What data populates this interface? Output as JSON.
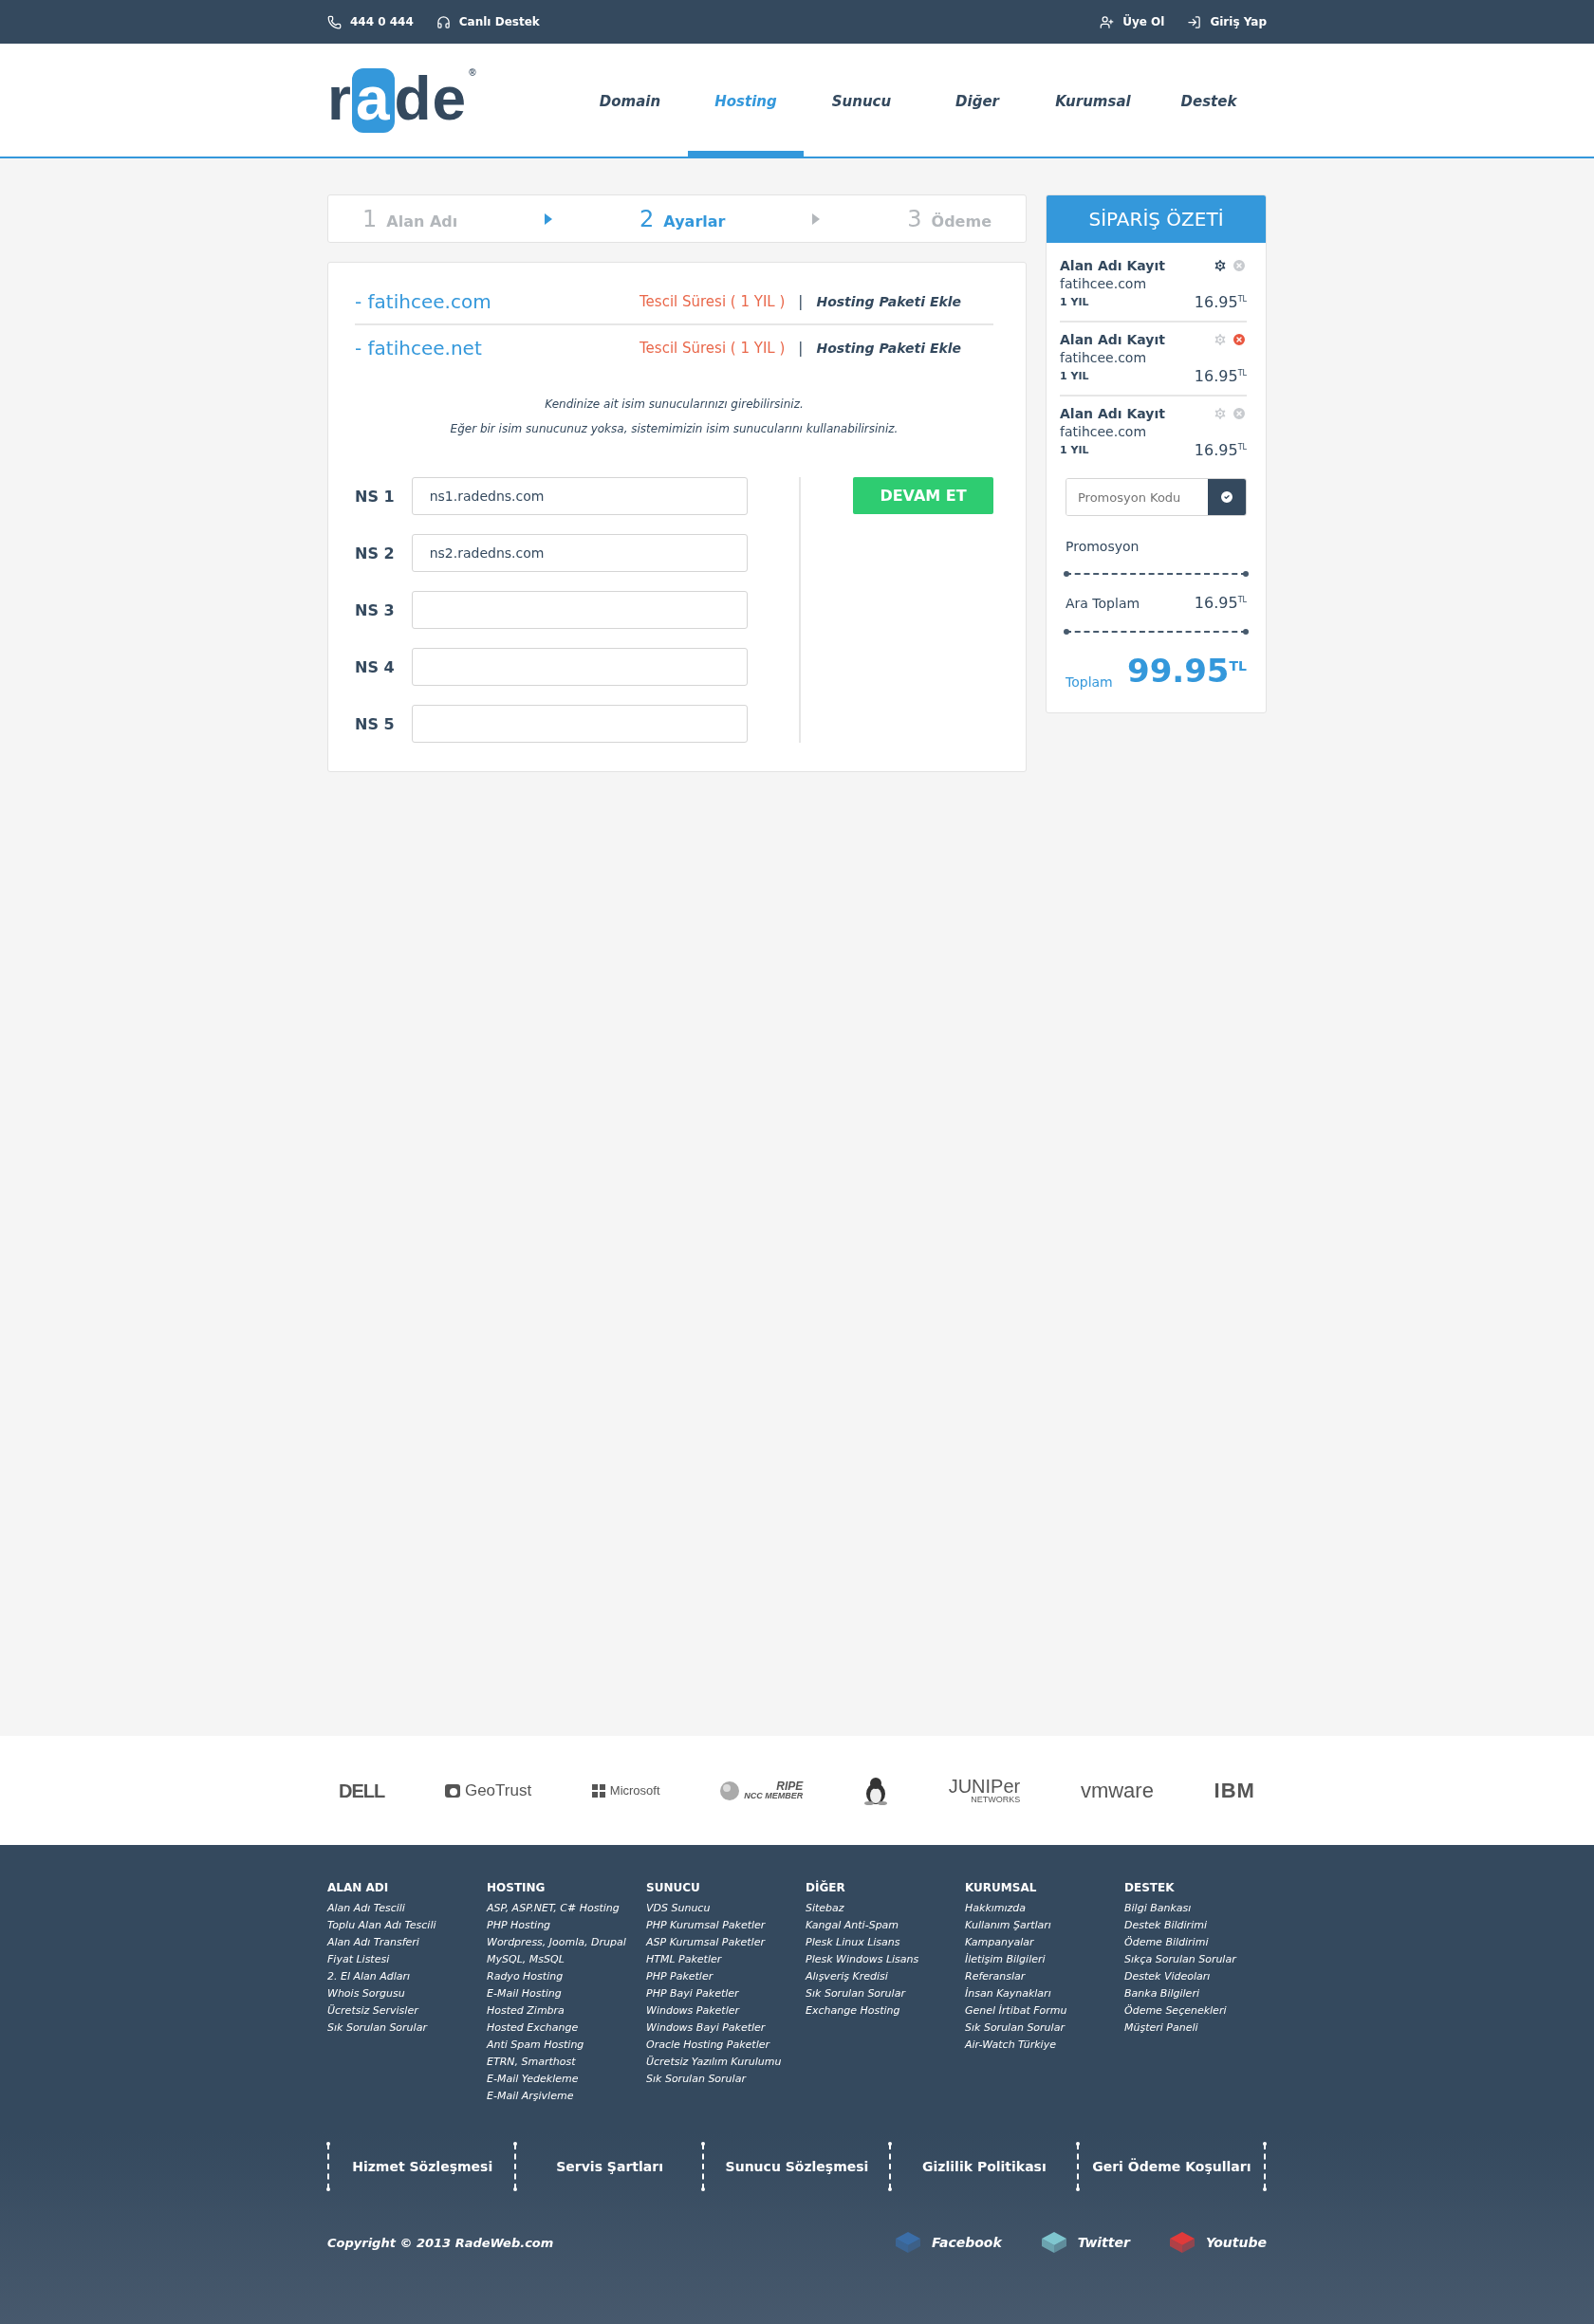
{
  "top_bar": {
    "left": [
      {
        "kind": "phone",
        "label": "444 0 444"
      },
      {
        "kind": "support",
        "label": "Canlı Destek"
      }
    ],
    "right": [
      {
        "kind": "register",
        "label": "Üye Ol"
      },
      {
        "kind": "login",
        "label": "Giriş Yap"
      }
    ]
  },
  "logo": {
    "parts": [
      {
        "text": "r",
        "highlight": false
      },
      {
        "text": "a",
        "highlight": true
      },
      {
        "text": "de",
        "highlight": false
      }
    ],
    "mark": "®"
  },
  "nav": [
    {
      "label": "Domain",
      "selected": false
    },
    {
      "label": "Hosting",
      "selected": true
    },
    {
      "label": "Sunucu",
      "selected": false
    },
    {
      "label": "Diğer",
      "selected": false
    },
    {
      "label": "Kurumsal",
      "selected": false
    },
    {
      "label": "Destek",
      "selected": false
    }
  ],
  "steps": [
    {
      "number": "1",
      "label": "Alan Adı",
      "selected": false
    },
    {
      "number": "2",
      "label": "Ayarlar",
      "selected": true
    },
    {
      "number": "3",
      "label": "Ödeme",
      "selected": false
    }
  ],
  "domains": [
    {
      "name": "- fatihcee.com",
      "period": "Tescil Süresi ( 1 YIL )",
      "separator": "|",
      "action": "Hosting Paketi Ekle"
    },
    {
      "name": "- fatihcee.net",
      "period": "Tescil Süresi ( 1 YIL )",
      "separator": "|",
      "action": "Hosting Paketi Ekle"
    }
  ],
  "info": [
    "Kendinize ait isim sunucularınızı girebilirsiniz.",
    "Eğer bir isim sunucunuz yoksa, sistemimizin isim sunucularını kullanabilirsiniz."
  ],
  "nameservers": [
    {
      "label": "NS 1",
      "value": "ns1.radedns.com"
    },
    {
      "label": "NS 2",
      "value": "ns2.radedns.com"
    },
    {
      "label": "NS 3"
    },
    {
      "label": "NS 4"
    },
    {
      "label": "NS 5"
    }
  ],
  "continue_button": "DEVAM ET",
  "summary": {
    "title": "SİPARİŞ ÖZETİ",
    "items": [
      {
        "title": "Alan Adı Kayıt",
        "domain": "fatihcee.com",
        "period": "1 YIL",
        "price": "16.95",
        "currency": "TL",
        "settings_active": true,
        "remove_active": false
      },
      {
        "title": "Alan Adı Kayıt",
        "domain": "fatihcee.com",
        "period": "1 YIL",
        "price": "16.95",
        "currency": "TL",
        "settings_active": false,
        "remove_active": true
      },
      {
        "title": "Alan Adı Kayıt",
        "domain": "fatihcee.com",
        "period": "1 YIL",
        "price": "16.95",
        "currency": "TL",
        "settings_active": false,
        "remove_active": false
      }
    ],
    "promo_placeholder": "Promosyon Kodu",
    "promo_label": "Promosyon",
    "subtotal_label": "Ara Toplam",
    "subtotal": "16.95",
    "subtotal_currency": "TL",
    "total_label": "Toplam",
    "total": "99.95",
    "total_currency": "TL"
  },
  "partners": [
    {
      "kind": "dell",
      "label": "DELL"
    },
    {
      "kind": "geotrust",
      "label": "GeoTrust"
    },
    {
      "kind": "microsoft",
      "label": "Microsoft"
    },
    {
      "kind": "ripe",
      "label": "RIPE",
      "sub": "NCC MEMBER"
    },
    {
      "kind": "linux"
    },
    {
      "kind": "juniper",
      "label": "JUNIPer",
      "sub": "NETWORKS"
    },
    {
      "kind": "vmware",
      "label": "vmware"
    },
    {
      "kind": "ibm",
      "label": "IBM"
    }
  ],
  "footer_columns": [
    {
      "title": "ALAN ADI",
      "links": [
        "Alan Adı Tescili",
        "Toplu Alan Adı Tescili",
        "Alan Adı Transferi",
        "Fiyat Listesi",
        "2. El Alan Adları",
        "Whois Sorgusu",
        "Ücretsiz Servisler",
        "Sık Sorulan Sorular"
      ]
    },
    {
      "title": "HOSTING",
      "links": [
        "ASP, ASP.NET, C# Hosting",
        "PHP Hosting",
        "Wordpress, Joomla, Drupal",
        "MySQL, MsSQL",
        "Radyo Hosting",
        "E-Mail Hosting",
        "Hosted Zimbra",
        "Hosted Exchange",
        "Anti Spam Hosting",
        "ETRN, Smarthost",
        "E-Mail Yedekleme",
        "E-Mail Arşivleme"
      ]
    },
    {
      "title": "SUNUCU",
      "links": [
        "VDS Sunucu",
        "PHP Kurumsal Paketler",
        "ASP Kurumsal Paketler",
        "HTML Paketler",
        "PHP Paketler",
        "PHP Bayi Paketler",
        "Windows Paketler",
        "Windows Bayi Paketler",
        "Oracle Hosting Paketler",
        "Ücretsiz Yazılım Kurulumu",
        "Sık Sorulan Sorular"
      ]
    },
    {
      "title": "DİĞER",
      "links": [
        "Sitebaz",
        "Kangal Anti-Spam",
        "Plesk Linux Lisans",
        "Plesk Windows Lisans",
        "Alışveriş Kredisi",
        "Sık Sorulan Sorular",
        "Exchange Hosting"
      ]
    },
    {
      "title": "KURUMSAL",
      "links": [
        "Hakkımızda",
        "Kullanım Şartları",
        "Kampanyalar",
        "İletişim Bilgileri",
        "Referanslar",
        "İnsan Kaynakları",
        "Genel İrtibat Formu",
        "Sık Sorulan Sorular",
        "Air-Watch Türkiye"
      ]
    },
    {
      "title": "DESTEK",
      "links": [
        "Bilgi Bankası",
        "Destek Bildirimi",
        "Ödeme Bildirimi",
        "Sıkça Sorulan Sorular",
        "Destek Videoları",
        "Banka Bilgileri",
        "Ödeme Seçenekleri",
        "Müşteri Paneli"
      ]
    }
  ],
  "legal_links": [
    "Hizmet Sözleşmesi",
    "Servis Şartları",
    "Sunucu Sözleşmesi",
    "Gizlilik Politikası",
    "Geri Ödeme Koşulları"
  ],
  "copyright": "Copyright © 2013 RadeWeb.com",
  "social": [
    {
      "label": "Facebook",
      "color": "#3b6ea8"
    },
    {
      "label": "Twitter",
      "color": "#7fc6cf"
    },
    {
      "label": "Youtube",
      "color": "#e03a3a"
    }
  ]
}
